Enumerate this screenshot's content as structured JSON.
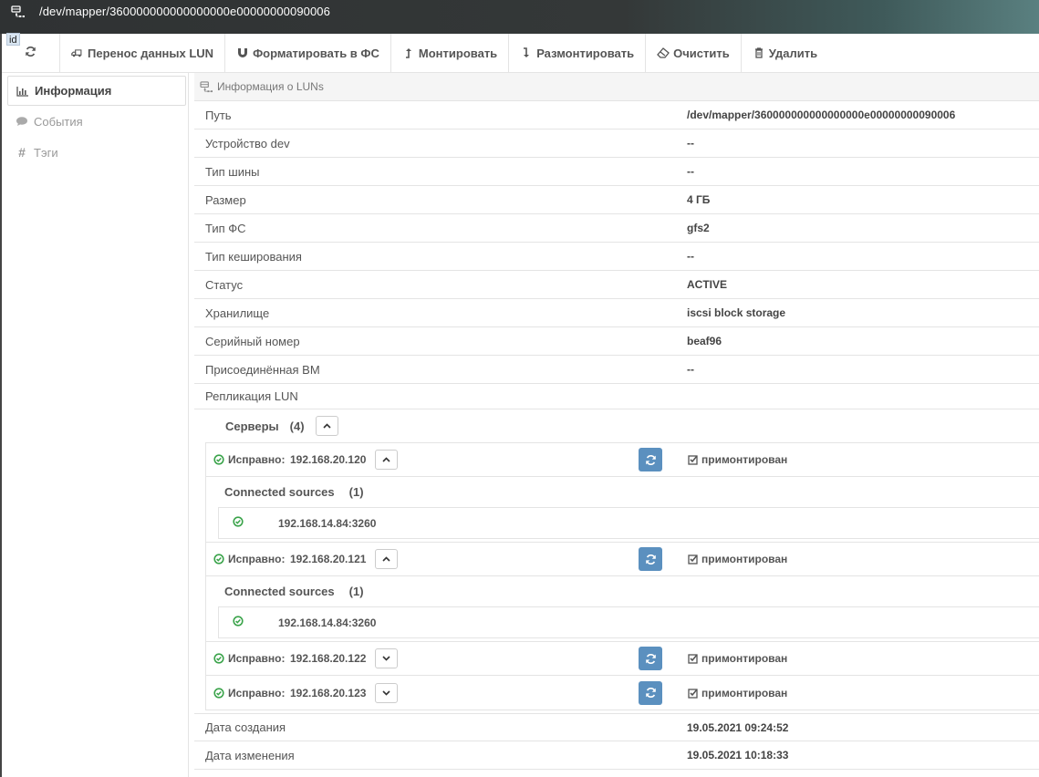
{
  "window": {
    "title": "/dev/mapper/360000000000000000e00000000090006",
    "id_badge": "id"
  },
  "toolbar": {
    "refresh_icon": "refresh-icon",
    "buttons": [
      {
        "label": "Перенос данных LUN",
        "icon": "truck-icon"
      },
      {
        "label": "Форматировать в ФС",
        "icon": "magnet-icon"
      },
      {
        "label": "Монтировать",
        "icon": "level-up-icon"
      },
      {
        "label": "Размонтировать",
        "icon": "level-down-icon"
      },
      {
        "label": "Очистить",
        "icon": "eraser-icon"
      },
      {
        "label": "Удалить",
        "icon": "trash-icon"
      }
    ]
  },
  "sidebar": {
    "items": [
      {
        "label": "Информация",
        "icon": "bar-chart-icon",
        "active": true
      },
      {
        "label": "События",
        "icon": "comment-icon",
        "active": false
      },
      {
        "label": "Тэги",
        "icon": "hash-icon",
        "active": false
      }
    ]
  },
  "panel": {
    "title": "Информация о LUNs",
    "rows": [
      {
        "label": "Путь",
        "value": "/dev/mapper/360000000000000000e00000000090006"
      },
      {
        "label": "Устройство dev",
        "value": "--"
      },
      {
        "label": "Тип шины",
        "value": "--"
      },
      {
        "label": "Размер",
        "value": "4 ГБ"
      },
      {
        "label": "Тип ФС",
        "value": "gfs2"
      },
      {
        "label": "Тип кеширования",
        "value": "--"
      },
      {
        "label": "Статус",
        "value": "ACTIVE"
      },
      {
        "label": "Хранилище",
        "value": "iscsi block storage"
      },
      {
        "label": "Серийный номер",
        "value": "beaf96"
      },
      {
        "label": "Присоединённая ВМ",
        "value": "--"
      }
    ],
    "replication": {
      "label": "Репликация LUN",
      "servers_label": "Серверы",
      "servers_count": "(4)",
      "servers": [
        {
          "status": "Исправно:",
          "ip": "192.168.20.120",
          "mount": "примонтирован",
          "expanded": true,
          "cs_label": "Connected sources",
          "cs_count": "(1)",
          "source": "192.168.14.84:3260"
        },
        {
          "status": "Исправно:",
          "ip": "192.168.20.121",
          "mount": "примонтирован",
          "expanded": true,
          "cs_label": "Connected sources",
          "cs_count": "(1)",
          "source": "192.168.14.84:3260"
        },
        {
          "status": "Исправно:",
          "ip": "192.168.20.122",
          "mount": "примонтирован",
          "expanded": false
        },
        {
          "status": "Исправно:",
          "ip": "192.168.20.123",
          "mount": "примонтирован",
          "expanded": false
        }
      ]
    },
    "dates": [
      {
        "label": "Дата создания",
        "value": "19.05.2021 09:24:52"
      },
      {
        "label": "Дата изменения",
        "value": "19.05.2021 10:18:33"
      }
    ]
  },
  "colors": {
    "ok_green": "#3aa34a",
    "action_blue": "#5b90bf",
    "titlebar": "#343838"
  }
}
